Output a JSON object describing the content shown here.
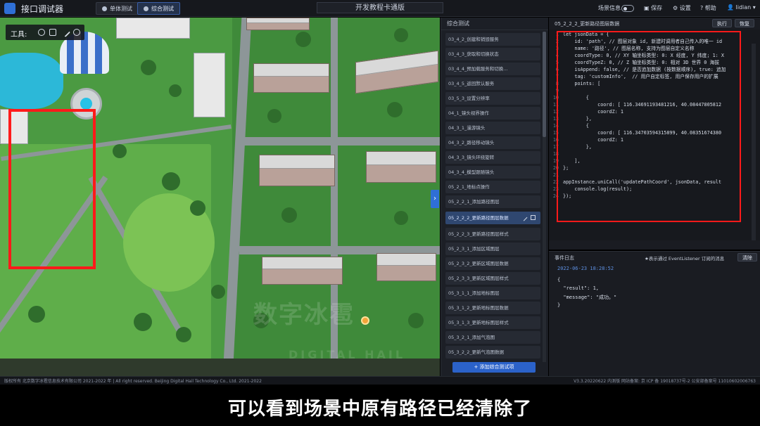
{
  "header": {
    "app_title": "接口调试器",
    "single_test": "单体测试",
    "combined_test": "综合测试",
    "center_title": "开发教程卡通版",
    "scene_info": "场景信息",
    "save": "保存",
    "settings": "设置",
    "help": "帮助",
    "user": "lidian"
  },
  "map": {
    "tool_label": "工具:",
    "watermark": "数字冰雹",
    "watermark_sub": "DIGITAL HAIL",
    "handle": "›"
  },
  "list_panel": {
    "title": "综合测试",
    "items": [
      "03_4_2_创建和销毁服务",
      "03_4_3_获取和切换状态",
      "03_4_4_预加载服务和切换...",
      "03_4_5_返回默认服务",
      "03_5_3_设置分辨率",
      "04_1_镜头视界操作",
      "04_3_1_漫游镜头",
      "04_3_2_路径移动镜头",
      "04_3_3_镜头环绕旋转",
      "04_3_4_模型跟随镜头",
      "05_2_1_地标点操作",
      "05_2_2_1_添加路径图层",
      "05_2_2_2_更新路径图层数据",
      "05_2_2_3_更新路径图层样式",
      "05_2_3_1_添加区域图层",
      "05_2_3_2_更新区域图层数据",
      "05_2_3_3_更新区域图层样式",
      "05_3_1_1_添加地标图层",
      "05_3_1_2_更新地标图层数据",
      "05_3_1_3_更新地标图层样式",
      "05_3_2_1_添加气泡图",
      "05_3_2_2_更新气泡图数据"
    ],
    "add_button": "+ 添加综合测试项"
  },
  "code_panel": {
    "title": "05_2_2_2_更新路径图层数据",
    "run": "执行",
    "restore": "恢复",
    "lines": [
      "let jsonData = {",
      "    id: 'path', // 图层对象 id, 新建时调用者自己传入的唯一 id",
      "    name: '路径', // 图层名称, 支持为图层自定义名称",
      "    coordType: 0, // XY 轴坐标类型: 0: X 经度, Y 纬度; 1: X",
      "    coordTypeZ: 0, // Z 轴坐标类型: 0: 相对 3D 世界 0 海拔",
      "    isAppend: false, // 是否追加数据 (按数据顺序), true: 追加",
      "    tag: 'customInfo',  // 用户自定标签, 用户保存用户的扩展",
      "    points: [",
      "",
      "        {",
      "            coord: [ 116.34691193481216, 40.08447805812",
      "            coordZ: 1",
      "        },",
      "        {",
      "            coord: [ 116.34703594315899, 40.08351674380",
      "            coordZ: 1",
      "        },",
      "",
      "    ],",
      "};",
      "",
      "appInstance.uniCall('updatePathCoord', jsonData, result",
      "    console.log(result);",
      "});"
    ]
  },
  "event_log": {
    "title": "事件日志",
    "hint": "★表示通过 EventListener 订阅的消息",
    "clear": "清除",
    "time": "2022-06-23 18:28:52",
    "lines": [
      "{",
      "  \"result\": 1,",
      "  \"message\": \"成功。\"",
      "}"
    ]
  },
  "footer": {
    "left": "版权所有 北京数字冰雹信息技术有限公司 2021-2022 年 | All right reserved. Beijing Digital Hail Technology Co., Ltd. 2021-2022",
    "right": "V3.3.20220622 内测版  网站备案: 京 ICP 备 19018737号-2 公安部备案号 11010602006763"
  },
  "subtitle": "可以看到场景中原有路径已经清除了",
  "colors": {
    "accent": "#2f6fd6",
    "highlight_box": "#ff1a1a",
    "selected_item": "#2f4770"
  }
}
